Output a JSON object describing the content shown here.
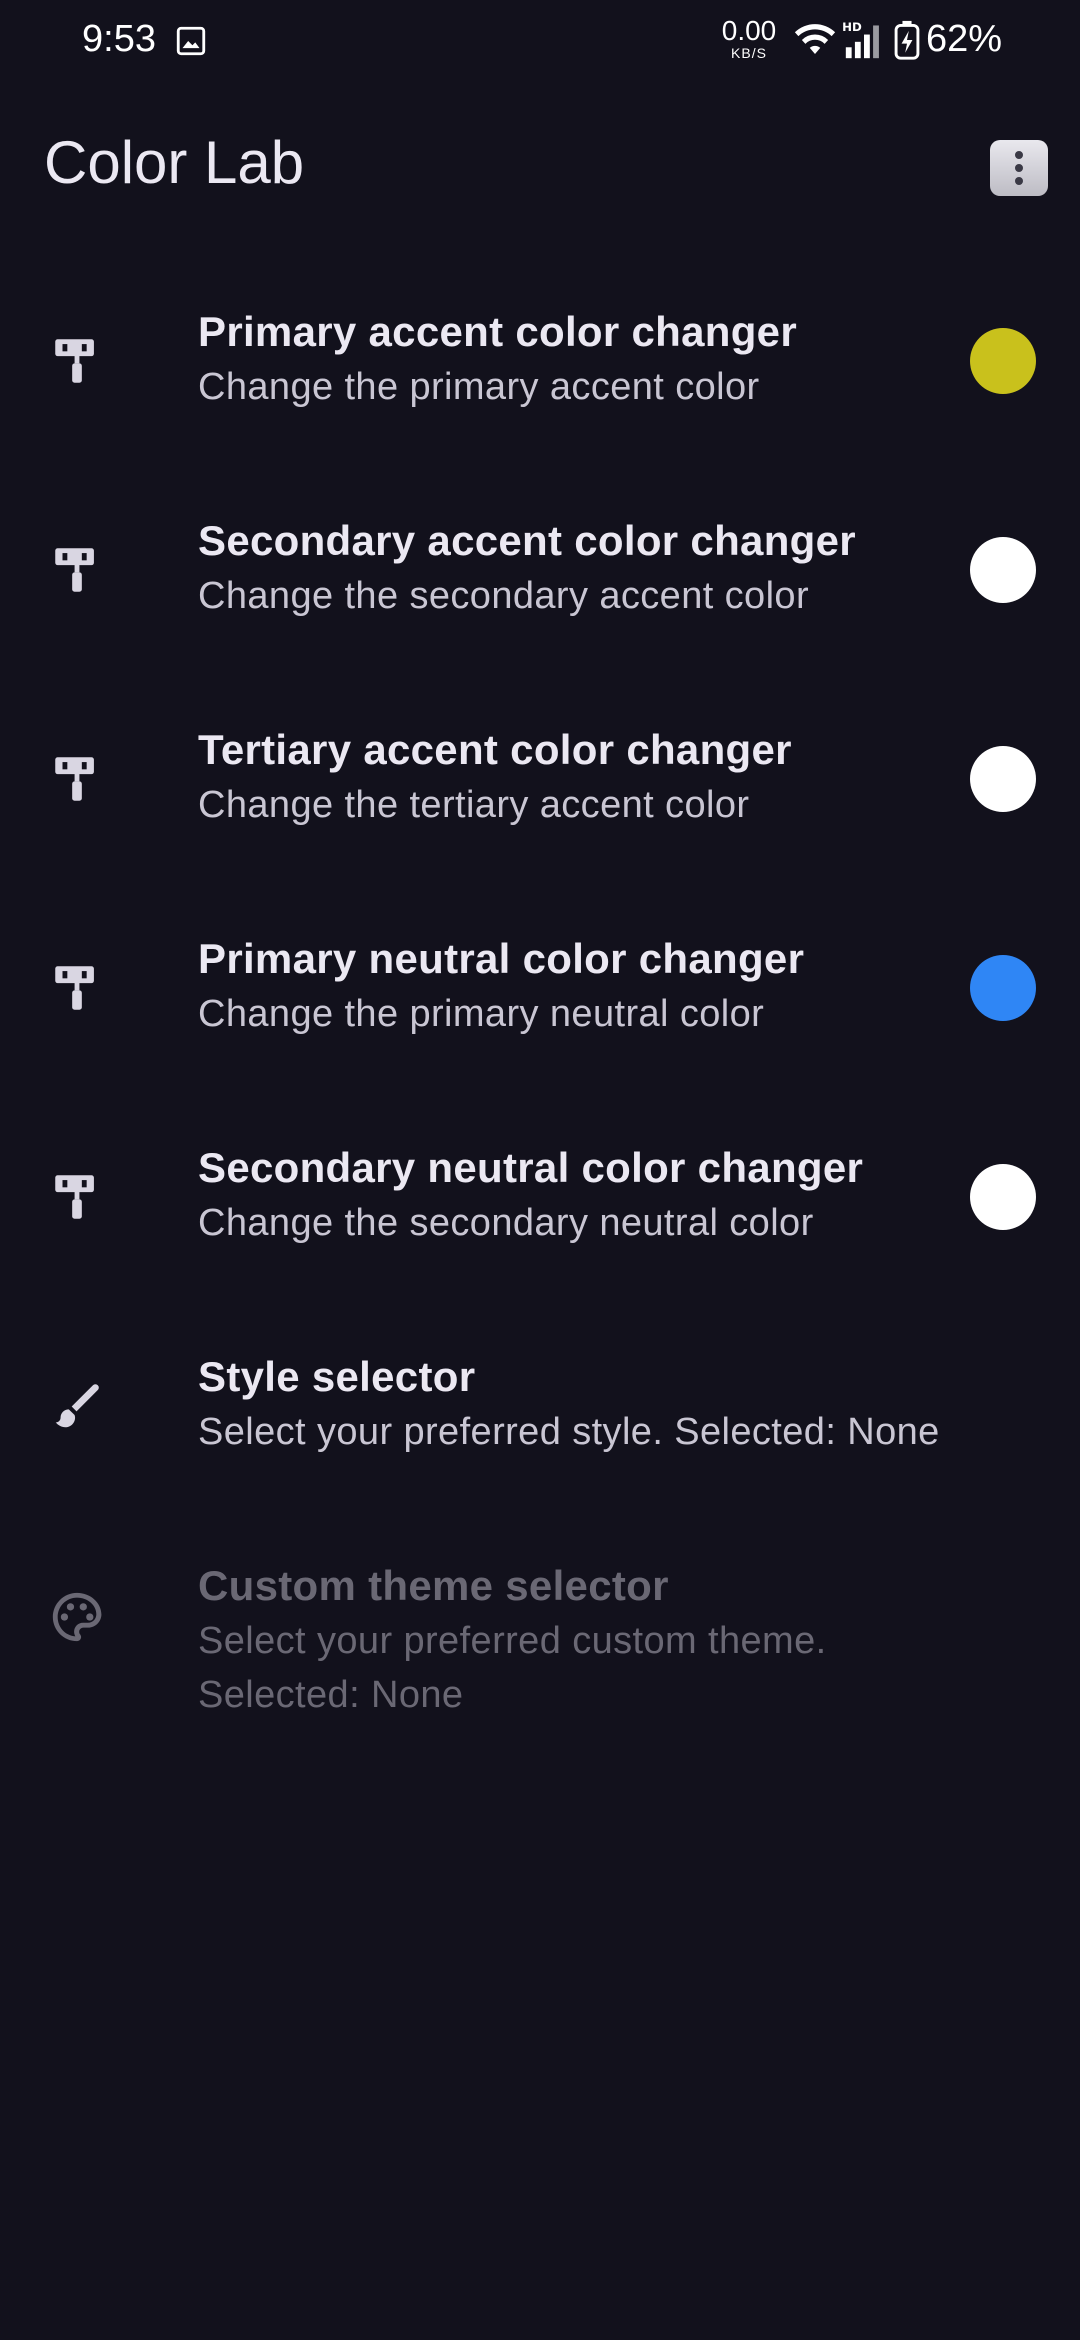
{
  "status_bar": {
    "time": "9:53",
    "net_speed_value": "0.00",
    "net_speed_unit": "KB/S",
    "battery_percent": "62%",
    "icons": [
      "gallery-icon",
      "wifi-icon",
      "hd-signal-icon",
      "battery-charging-icon"
    ]
  },
  "app_bar": {
    "title": "Color Lab",
    "menu_icon": "more-vert-icon"
  },
  "settings": [
    {
      "title": "Primary accent color changer",
      "summary": "Change the primary accent color",
      "icon": "paint-roller-icon",
      "swatch_color": "#c9c11c"
    },
    {
      "title": "Secondary accent color changer",
      "summary": "Change the secondary accent color",
      "icon": "paint-roller-icon",
      "swatch_color": "#ffffff"
    },
    {
      "title": "Tertiary accent color changer",
      "summary": "Change the tertiary accent color",
      "icon": "paint-roller-icon",
      "swatch_color": "#ffffff"
    },
    {
      "title": "Primary neutral color changer",
      "summary": "Change the primary neutral color",
      "icon": "paint-roller-icon",
      "swatch_color": "#2f86f5"
    },
    {
      "title": "Secondary neutral color changer",
      "summary": "Change the secondary neutral color",
      "icon": "paint-roller-icon",
      "swatch_color": "#ffffff"
    },
    {
      "title": "Style selector",
      "summary": "Select your preferred style. Selected: None",
      "icon": "brush-icon"
    },
    {
      "title": "Custom theme selector",
      "summary": "Select your preferred custom theme. Selected: None",
      "icon": "palette-icon",
      "disabled": true
    }
  ],
  "colors": {
    "background": "#12111c",
    "text_primary": "#ebe8f2",
    "text_secondary": "#c9c6d3",
    "text_disabled": "#6a6874"
  }
}
